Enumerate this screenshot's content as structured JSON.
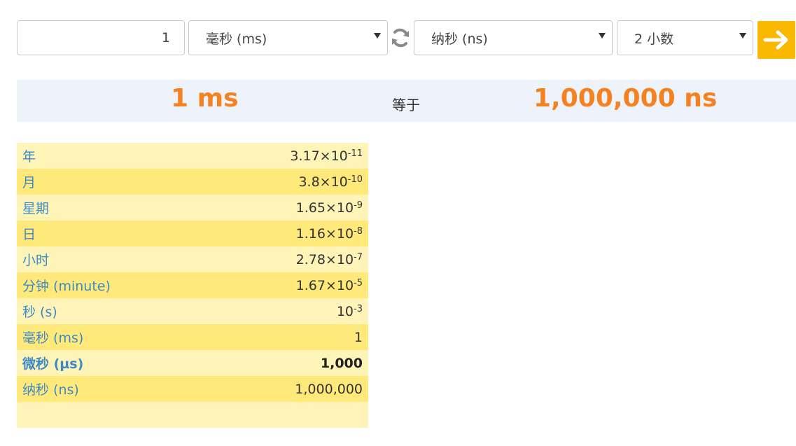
{
  "input": {
    "value": "1"
  },
  "from_unit": {
    "selected": "毫秒 (ms)"
  },
  "to_unit": {
    "selected": "纳秒 (ns)"
  },
  "decimals": {
    "selected": "2 小数"
  },
  "result": {
    "left": "1 ms",
    "equals": "等于",
    "right": "1,000,000 ns"
  },
  "table": [
    {
      "unit": "年",
      "mantissa": "3.17×10",
      "exp": "-11"
    },
    {
      "unit": "月",
      "mantissa": "3.8×10",
      "exp": "-10"
    },
    {
      "unit": "星期",
      "mantissa": "1.65×10",
      "exp": "-9"
    },
    {
      "unit": "日",
      "mantissa": "1.16×10",
      "exp": "-8"
    },
    {
      "unit": "小时",
      "mantissa": "2.78×10",
      "exp": "-7"
    },
    {
      "unit": "分钟 (minute)",
      "mantissa": "1.67×10",
      "exp": "-5"
    },
    {
      "unit": "秒 (s)",
      "mantissa": "10",
      "exp": "-3"
    },
    {
      "unit": "毫秒 (ms)",
      "mantissa": "1",
      "exp": null
    },
    {
      "unit": "微秒 (µs)",
      "mantissa": "1,000",
      "exp": null
    },
    {
      "unit": "纳秒 (ns)",
      "mantissa": "1,000,000",
      "exp": null
    },
    {
      "unit": "",
      "mantissa": "",
      "exp": null
    }
  ],
  "colors": {
    "accent": "#f58220",
    "go_button": "#fbb800",
    "row_light": "#fff4b8",
    "row_dark": "#ffe97a",
    "unit_text": "#3c8ac8",
    "result_bg": "#eef2fb"
  },
  "icons": {
    "swap": "refresh-swap-icon",
    "go": "arrow-right-icon",
    "dropdown": "caret-down-icon"
  }
}
